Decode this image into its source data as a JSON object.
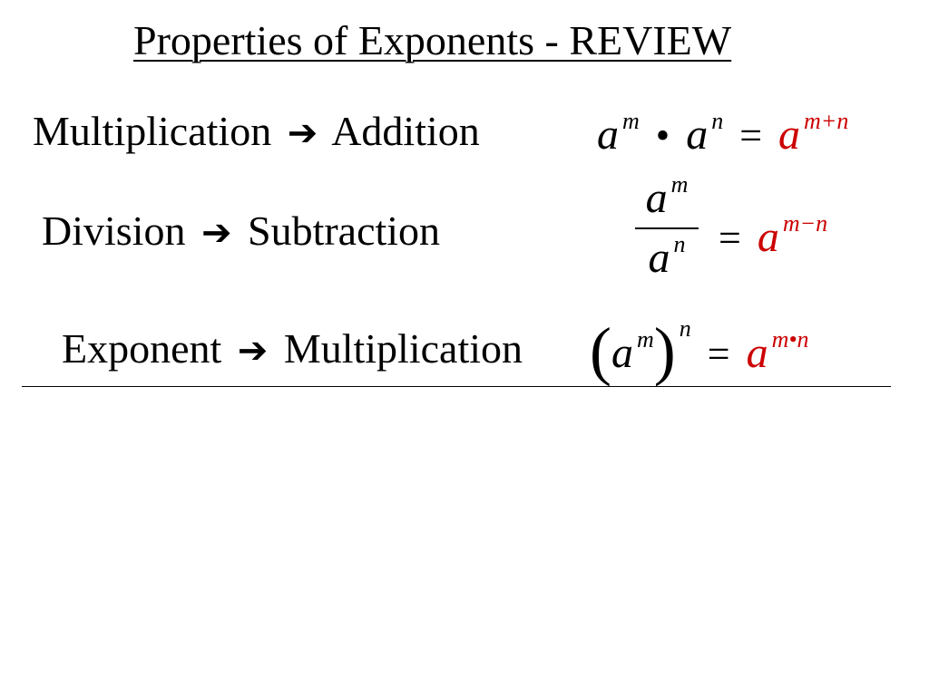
{
  "colors": {
    "accent": "#cc0000",
    "text": "#000000",
    "background": "#ffffff"
  },
  "title": "Properties of Exponents - REVIEW",
  "arrow_icon": "right-arrow-icon",
  "rules": [
    {
      "left": "Multiplication",
      "right": "Addition",
      "formula": {
        "base": "a",
        "exp1": "m",
        "op": "•",
        "exp2": "n",
        "equals": "=",
        "result_exp": "m+n"
      }
    },
    {
      "left": "Division",
      "right": "Subtraction",
      "formula": {
        "base": "a",
        "numerator_exp": "m",
        "denominator_exp": "n",
        "equals": "=",
        "result_exp": "m−n"
      }
    },
    {
      "left": "Exponent",
      "right": "Multiplication",
      "formula": {
        "base": "a",
        "inner_exp": "m",
        "outer_exp": "n",
        "equals": "=",
        "result_exp": "m•n"
      }
    }
  ]
}
